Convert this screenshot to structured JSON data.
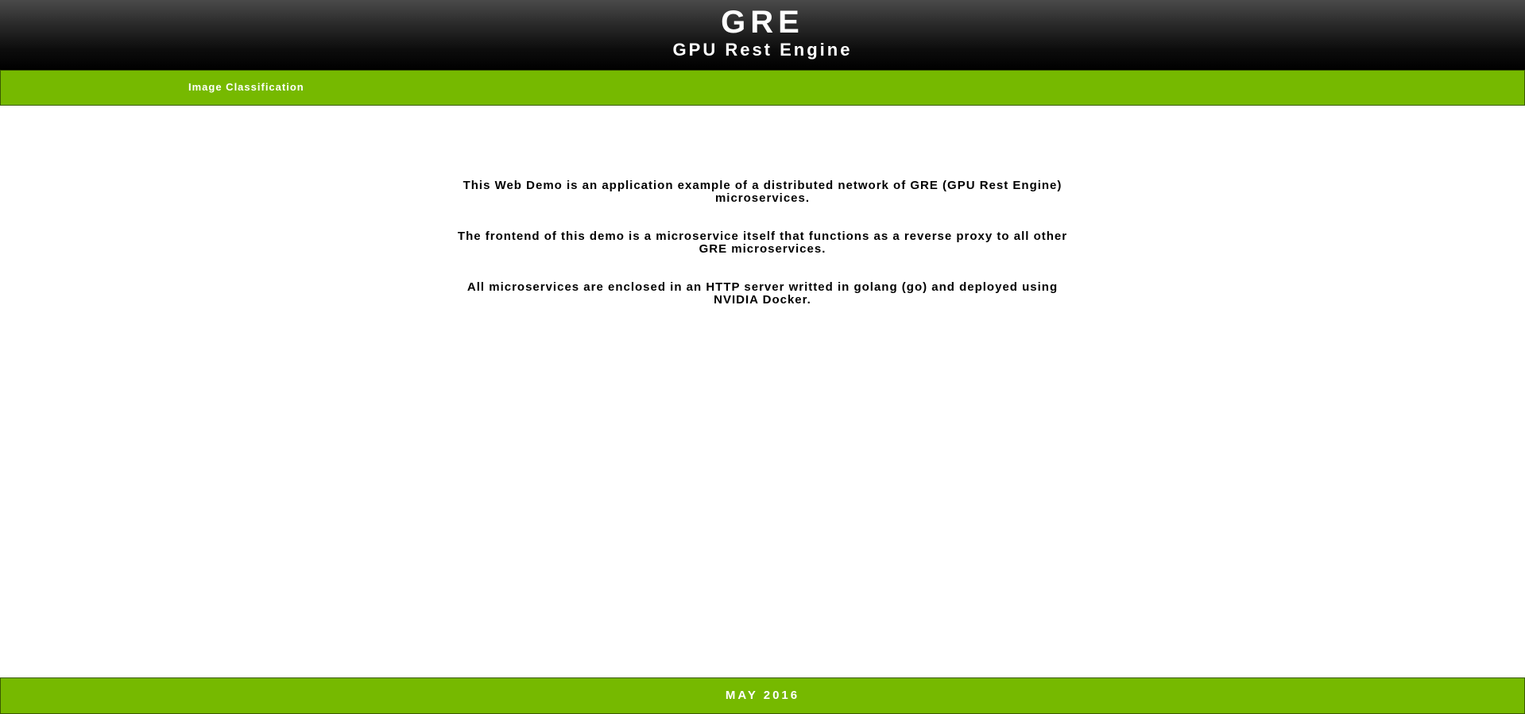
{
  "header": {
    "title": "GRE",
    "subtitle": "GPU Rest Engine"
  },
  "nav": {
    "items": [
      {
        "label": "Image Classification"
      }
    ]
  },
  "main": {
    "paragraphs": [
      "This Web Demo is an application example of a distributed network of GRE (GPU Rest Engine) microservices.",
      "The frontend of this demo is a microservice itself that functions as a reverse proxy to all other GRE microservices.",
      "All microservices are enclosed in an HTTP server writted in golang (go) and deployed using NVIDIA Docker."
    ]
  },
  "footer": {
    "text": "MAY 2016"
  },
  "colors": {
    "accent_green": "#76b900",
    "header_top": "#4a4a4a",
    "header_bottom": "#000000",
    "text": "#000000"
  }
}
